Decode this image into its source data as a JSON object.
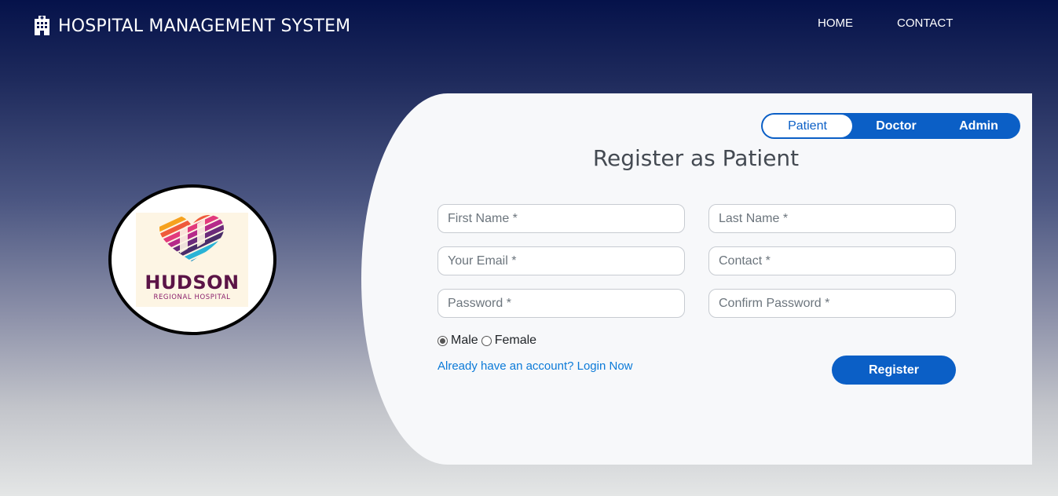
{
  "navbar": {
    "brand_icon": "hospital-building-icon",
    "title": "HOSPITAL MANAGEMENT SYSTEM",
    "links": [
      {
        "label": "HOME"
      },
      {
        "label": "CONTACT"
      }
    ]
  },
  "logo": {
    "name": "HUDSON",
    "subtitle": "REGIONAL HOSPITAL",
    "icon": "heart-stripes-logo"
  },
  "tabs": [
    {
      "label": "Patient",
      "active": true
    },
    {
      "label": "Doctor",
      "active": false
    },
    {
      "label": "Admin",
      "active": false
    }
  ],
  "form": {
    "title": "Register as Patient",
    "fields": {
      "first_name": {
        "placeholder": "First Name *",
        "value": ""
      },
      "last_name": {
        "placeholder": "Last Name *",
        "value": ""
      },
      "email": {
        "placeholder": "Your Email *",
        "value": ""
      },
      "contact": {
        "placeholder": "Contact *",
        "value": ""
      },
      "password": {
        "placeholder": "Password *",
        "value": ""
      },
      "confirm_password": {
        "placeholder": "Confirm Password *",
        "value": ""
      }
    },
    "gender": {
      "options": [
        {
          "label": "Male",
          "checked": true
        },
        {
          "label": "Female",
          "checked": false
        }
      ]
    },
    "login_link": "Already have an account? Login Now",
    "submit_label": "Register"
  },
  "colors": {
    "accent": "#0b5fc6",
    "link": "#0b7ad8",
    "nav_bg_top": "#05124a",
    "panel_bg": "#f7f8fa"
  }
}
